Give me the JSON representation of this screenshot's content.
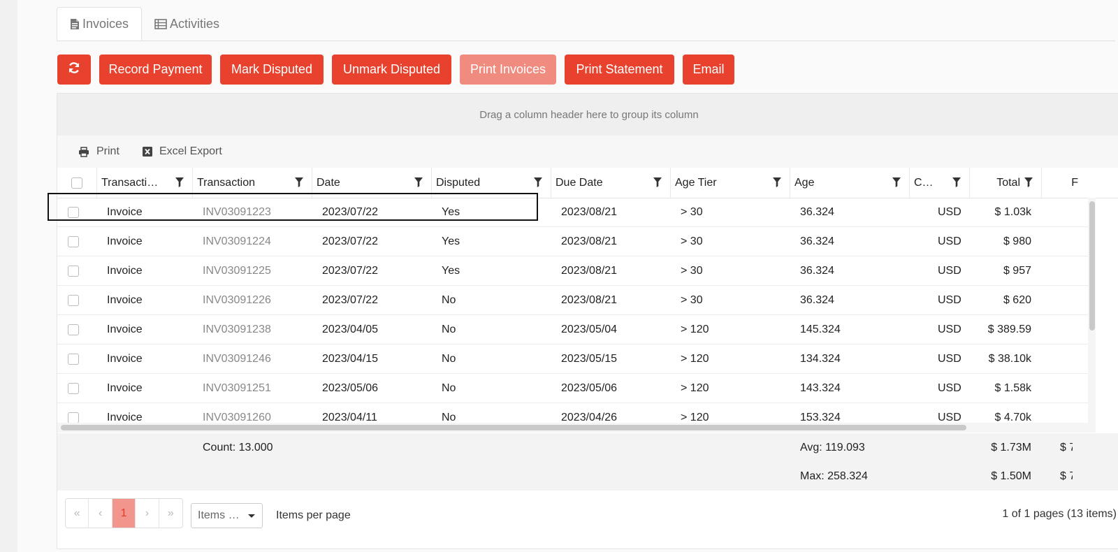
{
  "tabs": [
    {
      "label": "Invoices",
      "icon": "file-text-icon",
      "active": true
    },
    {
      "label": "Activities",
      "icon": "table-list-icon",
      "active": false
    }
  ],
  "toolbar": {
    "refresh_icon": "refresh-icon",
    "record_payment": "Record Payment",
    "mark_disputed": "Mark Disputed",
    "unmark_disputed": "Unmark Disputed",
    "print_invoices": "Print Invoices",
    "print_statement": "Print Statement",
    "email": "Email"
  },
  "grid": {
    "group_panel_text": "Drag a column header here to group its column",
    "tools": {
      "print": "Print",
      "excel_export": "Excel Export"
    },
    "columns": [
      "Transacti…",
      "Transaction",
      "Date",
      "Disputed",
      "Due Date",
      "Age Tier",
      "Age",
      "C…",
      "Total",
      "F"
    ],
    "rows": [
      {
        "type": "Invoice",
        "transaction": "INV03091223",
        "date": "2023/07/22",
        "disputed": "Yes",
        "due_date": "2023/08/21",
        "age_tier": "> 30",
        "age": "36.324",
        "currency": "USD",
        "total": "$ 1.03k"
      },
      {
        "type": "Invoice",
        "transaction": "INV03091224",
        "date": "2023/07/22",
        "disputed": "Yes",
        "due_date": "2023/08/21",
        "age_tier": "> 30",
        "age": "36.324",
        "currency": "USD",
        "total": "$ 980"
      },
      {
        "type": "Invoice",
        "transaction": "INV03091225",
        "date": "2023/07/22",
        "disputed": "Yes",
        "due_date": "2023/08/21",
        "age_tier": "> 30",
        "age": "36.324",
        "currency": "USD",
        "total": "$ 957"
      },
      {
        "type": "Invoice",
        "transaction": "INV03091226",
        "date": "2023/07/22",
        "disputed": "No",
        "due_date": "2023/08/21",
        "age_tier": "> 30",
        "age": "36.324",
        "currency": "USD",
        "total": "$ 620"
      },
      {
        "type": "Invoice",
        "transaction": "INV03091238",
        "date": "2023/04/05",
        "disputed": "No",
        "due_date": "2023/05/04",
        "age_tier": "> 120",
        "age": "145.324",
        "currency": "USD",
        "total": "$ 389.59"
      },
      {
        "type": "Invoice",
        "transaction": "INV03091246",
        "date": "2023/04/15",
        "disputed": "No",
        "due_date": "2023/05/15",
        "age_tier": "> 120",
        "age": "134.324",
        "currency": "USD",
        "total": "$ 38.10k"
      },
      {
        "type": "Invoice",
        "transaction": "INV03091251",
        "date": "2023/05/06",
        "disputed": "No",
        "due_date": "2023/05/06",
        "age_tier": "> 120",
        "age": "143.324",
        "currency": "USD",
        "total": "$ 1.58k"
      },
      {
        "type": "Invoice",
        "transaction": "INV03091260",
        "date": "2023/04/11",
        "disputed": "No",
        "due_date": "2023/04/26",
        "age_tier": "> 120",
        "age": "153.324",
        "currency": "USD",
        "total": "$ 4.70k"
      }
    ],
    "footer": {
      "count": "Count: 13.000",
      "avg_age": "Avg: 119.093",
      "avg_total": "$ 1.73M",
      "avg_extra": "$ 7",
      "max_age": "Max: 258.324",
      "max_total": "$ 1.50M",
      "max_extra": "$ 7"
    }
  },
  "pager": {
    "first_icon": "«",
    "prev_icon": "‹",
    "current_page": "1",
    "next_icon": "›",
    "last_icon": "»",
    "items_select": "Items …",
    "items_per_page_label": "Items per page",
    "info": "1 of 1 pages (13 items)"
  },
  "colors": {
    "accent": "#e8412e",
    "accent_light": "#f08b80",
    "link_grey": "#888888"
  }
}
